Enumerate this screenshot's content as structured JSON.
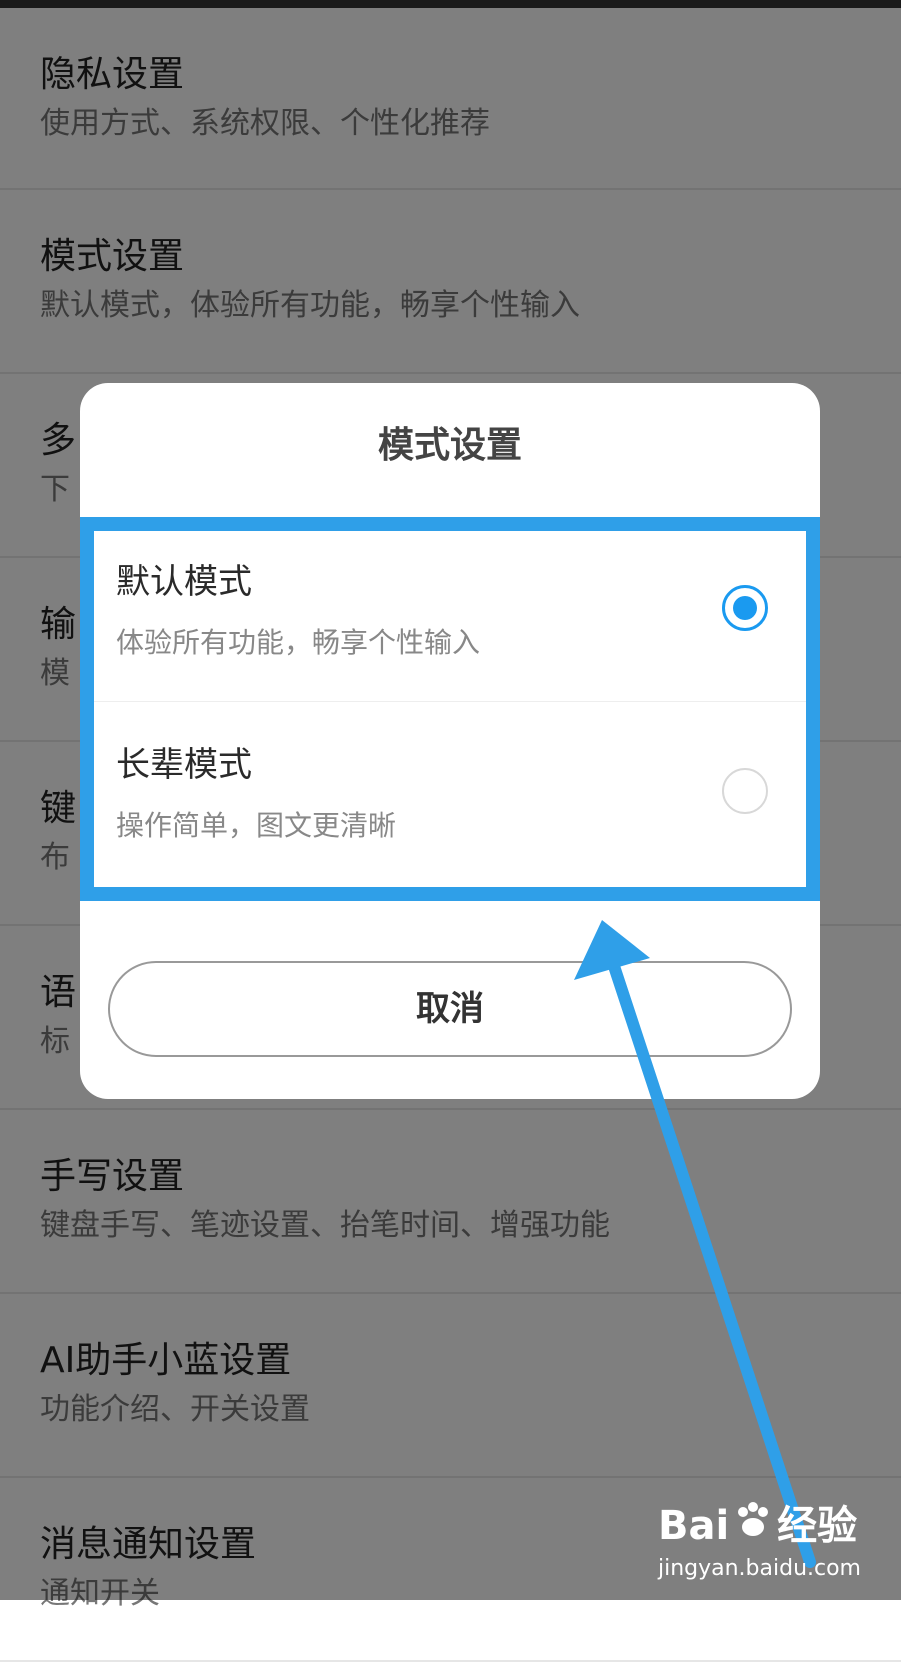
{
  "settings": {
    "items": [
      {
        "title": "隐私设置",
        "subtitle": "使用方式、系统权限、个性化推荐"
      },
      {
        "title": "模式设置",
        "subtitle": "默认模式，体验所有功能，畅享个性输入"
      },
      {
        "title": "多",
        "subtitle": "下"
      },
      {
        "title": "输",
        "subtitle": "模"
      },
      {
        "title": "键",
        "subtitle": "布"
      },
      {
        "title": "语",
        "subtitle": "标"
      },
      {
        "title": "手写设置",
        "subtitle": "键盘手写、笔迹设置、抬笔时间、增强功能"
      },
      {
        "title": "AI助手小蓝设置",
        "subtitle": "功能介绍、开关设置"
      },
      {
        "title": "消息通知设置",
        "subtitle": "通知开关"
      }
    ]
  },
  "dialog": {
    "title": "模式设置",
    "options": [
      {
        "title": "默认模式",
        "subtitle": "体验所有功能，畅享个性输入",
        "selected": true
      },
      {
        "title": "长辈模式",
        "subtitle": "操作简单，图文更清晰",
        "selected": false
      }
    ],
    "cancel_label": "取消"
  },
  "annotation": {
    "color": "#2f9fe8"
  },
  "watermark": {
    "brand_left": "Bai",
    "brand_right": "经验",
    "url": "jingyan.baidu.com"
  },
  "colors": {
    "accent": "#1a9af0",
    "overlay": "rgba(0,0,0,0.5)"
  }
}
